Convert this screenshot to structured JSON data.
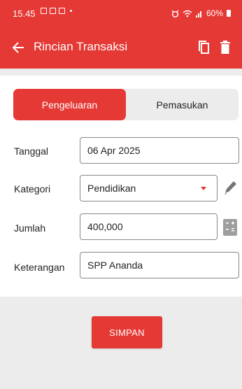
{
  "status_bar": {
    "time": "15.45",
    "battery": "60%"
  },
  "app_bar": {
    "title": "Rincian Transaksi"
  },
  "tabs": [
    {
      "label": "Pengeluaran",
      "active": true
    },
    {
      "label": "Pemasukan",
      "active": false
    }
  ],
  "form": {
    "tanggal": {
      "label": "Tanggal",
      "value": "06 Apr 2025"
    },
    "kategori": {
      "label": "Kategori",
      "value": "Pendidikan"
    },
    "jumlah": {
      "label": "Jumlah",
      "value": "400,000"
    },
    "keterangan": {
      "label": "Keterangan",
      "value": "SPP Ananda"
    }
  },
  "save_button": {
    "label": "SIMPAN"
  },
  "colors": {
    "accent": "#e53935",
    "background": "#ececec"
  },
  "icons": [
    "back-arrow-icon",
    "copy-icon",
    "trash-icon",
    "dropdown-arrow-icon",
    "edit-pencil-icon",
    "calculator-icon"
  ]
}
